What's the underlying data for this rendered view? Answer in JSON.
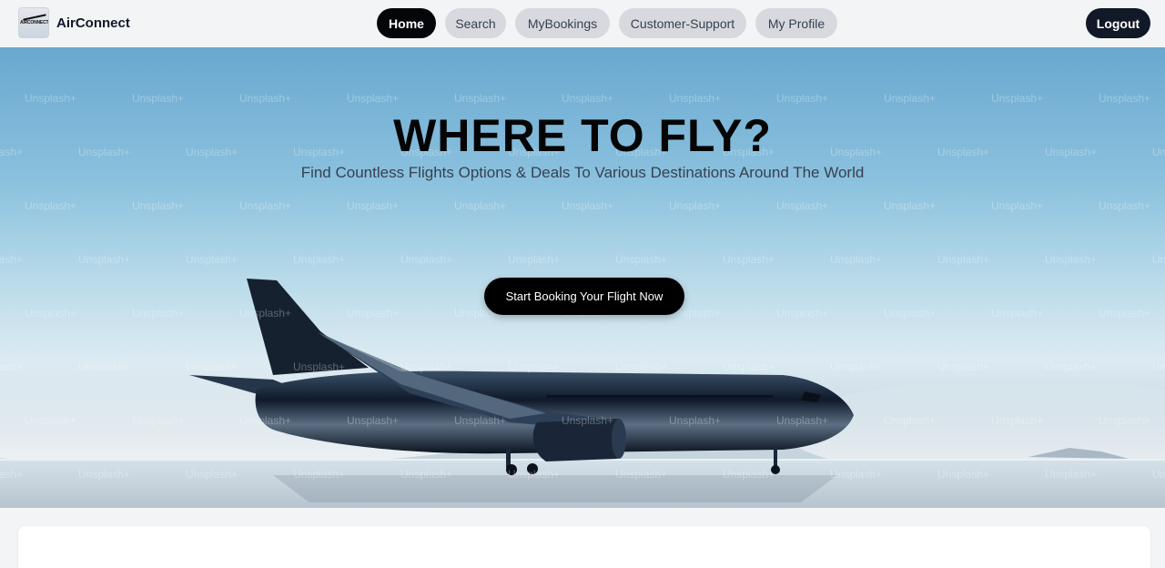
{
  "app": {
    "name": "AirConnect",
    "logo_text": "AIRCONNECT"
  },
  "nav": {
    "items": [
      {
        "label": "Home",
        "active": true
      },
      {
        "label": "Search",
        "active": false
      },
      {
        "label": "MyBookings",
        "active": false
      },
      {
        "label": "Customer-Support",
        "active": false
      },
      {
        "label": "My Profile",
        "active": false
      }
    ],
    "logout_label": "Logout"
  },
  "hero": {
    "title": "WHERE TO FLY?",
    "subtitle": "Find Countless Flights Options & Deals To Various Destinations Around The World",
    "cta_label": "Start Booking Your Flight Now",
    "watermark_text": "Unsplash+",
    "image_icon": "airplane-photo"
  },
  "colors": {
    "accent": "#05060a",
    "logout_bg": "#111827",
    "pill_bg": "#d7d9de",
    "page_bg": "#f3f4f6"
  }
}
